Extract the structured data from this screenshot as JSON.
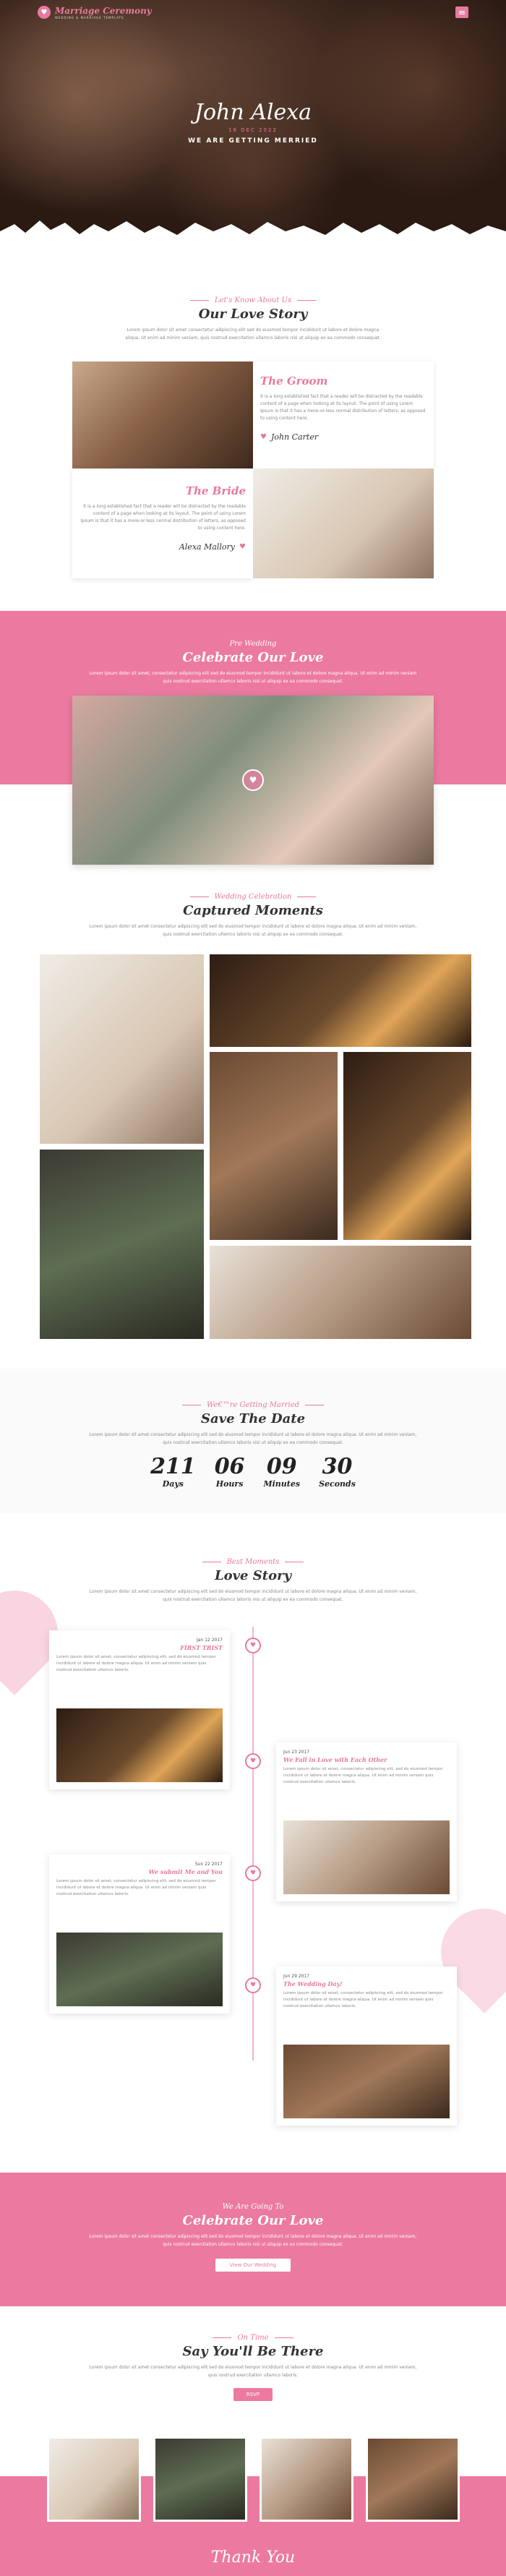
{
  "brand": {
    "name": "Marriage Ceremony",
    "tagline": "WEDDING & MARRIAGE TEMPLATE"
  },
  "hero": {
    "names": "John Alexa",
    "date": "16 DEC 2022",
    "headline": "WE ARE GETTING MERRIED"
  },
  "about": {
    "subtitle": "Let's Know About Us",
    "title": "Our Love Story",
    "text": "Lorem ipsum dolor sit amet consectetur adipiscing elit sed do eiusmod tempor incididunt ut labore et dolore magna aliqua. Ut enim ad minim veniam, quis nostrud exercitation ullamco laboris nisi ut aliquip ex ea commodo consequat.",
    "groom": {
      "title": "The Groom",
      "text": "It is a long established fact that a reader will be distracted by the readable content of a page when looking at its layout. The point of using Lorem Ipsum is that it has a more-or-less normal distribution of letters, as opposed to using content here.",
      "sign": "John Carter"
    },
    "bride": {
      "title": "The Bride",
      "text": "It is a long established fact that a reader will be distracted by the readable content of a page when looking at its layout. The point of using Lorem Ipsum is that it has a more-or-less normal distribution of letters, as opposed to using content here.",
      "sign": "Alexa Mallory"
    }
  },
  "prewed": {
    "subtitle": "Pre Wedding",
    "title": "Celebrate Our Love",
    "text": "Lorem ipsum dolor sit amet, consectetur adipiscing elit sed do eiusmod tempor incididunt ut labore et dolore magna aliqua. Ut enim ad minim veniam quis nostrud exercitation ullamco laboris nisi ut aliquip ex ea commodo consequat."
  },
  "gallery": {
    "subtitle": "Wedding Celebration",
    "title": "Captured Moments",
    "text": "Lorem ipsum dolor sit amet consectetur adipiscing elit sed do eiusmod tempor incididunt ut labore et dolore magna aliqua. Ut enim ad minim veniam, quis nostrud exercitation ullamco laboris nisi ut aliquip ex ea commodo consequat."
  },
  "countdown": {
    "subtitle": "We€™re Getting Married",
    "title": "Save The Date",
    "text": "Lorem ipsum dolor sit amet consectetur adipiscing elit sed do eiusmod tempor incididunt ut labore et dolore magna aliqua. Ut enim ad minim veniam, quis nostrud exercitation ullamco laboris nisi ut aliquip ex ea commodo consequat.",
    "units": [
      {
        "value": "211",
        "label": "Days"
      },
      {
        "value": "06",
        "label": "Hours"
      },
      {
        "value": "09",
        "label": "Minutes"
      },
      {
        "value": "30",
        "label": "Seconds"
      }
    ]
  },
  "story": {
    "subtitle": "Best Moments",
    "title": "Love Story",
    "text": "Lorem ipsum dolor sit amet consectetur adipiscing elit sed do eiusmod tempor incididunt ut labore et dolore magna aliqua. Ut enim ad minim veniam, quis nostrud exercitation ullamco laboris nisi ut aliquip ex ea commodo consequat.",
    "events": [
      {
        "date": "Jan 12 2017",
        "title": "FIRST TRIST",
        "text": "Lorem ipsum dolor sit amet, consectetur adipiscing elit, sed do eiusmod tempor incididunt ut labore et dolore magna aliqua. Ut enim ad minim veniam quis nostrud exercitation ullamco laboris."
      },
      {
        "date": "Jun 23 2017",
        "title": "We Fall in Love with Each Other",
        "text": "Lorem ipsum dolor sit amet, consectetur adipiscing elit, sed do eiusmod tempor incididunt ut labore et dolore magna aliqua. Ut enim ad minim veniam quis nostrud exercitation ullamco laboris."
      },
      {
        "date": "Sun 22 2017",
        "title": "We submit Me and You",
        "text": "Lorem ipsum dolor sit amet, consectetur adipiscing elit, sed do eiusmod tempor incididunt ut labore et dolore magna aliqua. Ut enim ad minim veniam quis nostrud exercitation ullamco laboris."
      },
      {
        "date": "Jun 29 2017",
        "title": "The Wedding Day!",
        "text": "Lorem ipsum dolor sit amet, consectetur adipiscing elit, sed do eiusmod tempor incididunt ut labore et dolore magna aliqua. Ut enim ad minim veniam quis nostrud exercitation ullamco laboris."
      }
    ]
  },
  "going": {
    "subtitle": "We Are Going To",
    "title": "Celebrate Our Love",
    "text": "Lorem ipsum dolor sit amet consectetur adipiscing elit sed do eiusmod tempor incididunt ut labore et dolore magna aliqua. Ut enim ad minim veniam, quis nostrud exercitation ullamco laboris nisi ut aliquip ex ea commodo consequat.",
    "button": "View Our Wedding"
  },
  "rsvp": {
    "subtitle": "On Time",
    "title": "Say You'll Be There",
    "text": "Lorem ipsum dolor sit amet consectetur adipiscing elit sed do eiusmod tempor incididunt ut labore et dolore magna aliqua. Ut enim ad minim veniam, quis nostrud exercitation ullamco laboris.",
    "button": "RSVP"
  },
  "footer": {
    "thanks": "Thank You"
  },
  "colors": {
    "accent": "#e8799f",
    "dark": "#2a1a12"
  },
  "icons": {
    "menu": "menu-icon",
    "heart": "heart-icon",
    "logo": "rings-logo-icon"
  }
}
